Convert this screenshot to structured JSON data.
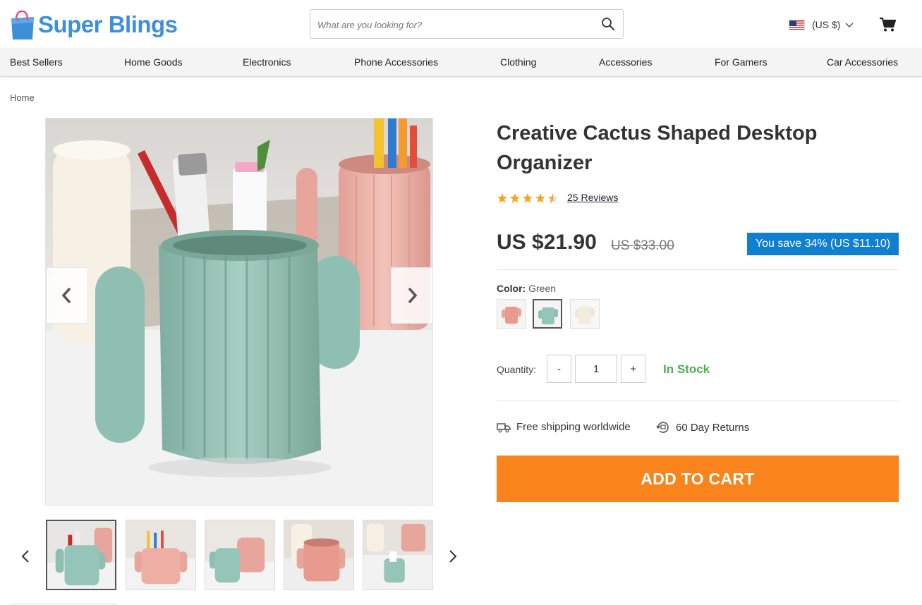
{
  "brand": {
    "name": "Super Blings",
    "accent": "#3d8fd8"
  },
  "search": {
    "placeholder": "What are you looking for?",
    "value": ""
  },
  "currency": {
    "label": "(US $)",
    "flag": "us-flag-icon"
  },
  "nav": {
    "items": [
      "Best Sellers",
      "Home Goods",
      "Electronics",
      "Phone Accessories",
      "Clothing",
      "Accessories",
      "For Gamers",
      "Car Accessories"
    ]
  },
  "breadcrumb": {
    "home": "Home"
  },
  "product": {
    "title": "Creative Cactus Shaped Desktop Organizer",
    "rating": 4.5,
    "rating_max": 5,
    "reviews_label": "25 Reviews",
    "price": "US $21.90",
    "old_price": "US $33.00",
    "save_label": "You save 34% (US $11.10)",
    "color_label": "Color:",
    "color_value": "Green",
    "colors": [
      "Pink",
      "Green",
      "White"
    ],
    "selected_color_index": 1,
    "quantity_label": "Quantity:",
    "quantity": "1",
    "qty_minus": "-",
    "qty_plus": "+",
    "stock_status": "In Stock",
    "shipping_label": "Free shipping worldwide",
    "returns_label": "60 Day Returns",
    "add_to_cart_label": "ADD TO CART",
    "thumbnails_count": 5,
    "active_thumbnail_index": 0
  },
  "colors": {
    "primary_blue": "#0f7fcf",
    "cta_orange": "#f8841b",
    "stock_green": "#4caf50",
    "star_orange": "#f5a623",
    "cactus_green": "#8fbfb3",
    "cactus_pink": "#e7a59b"
  }
}
